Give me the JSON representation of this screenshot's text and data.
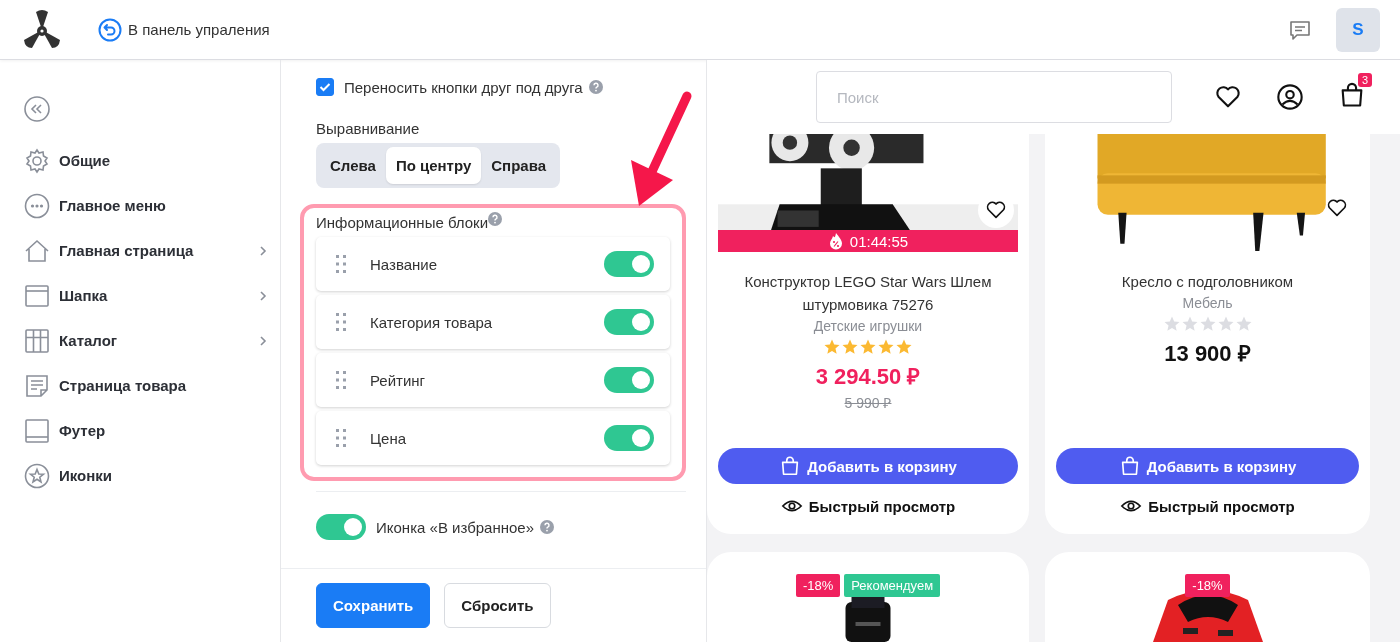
{
  "header": {
    "back_link": "В панель упраления",
    "avatar": "S"
  },
  "sidebar": {
    "items": [
      {
        "label": "Общие",
        "expandable": false
      },
      {
        "label": "Главное меню",
        "expandable": false
      },
      {
        "label": "Главная страница",
        "expandable": true
      },
      {
        "label": "Шапка",
        "expandable": true
      },
      {
        "label": "Каталог",
        "expandable": true
      },
      {
        "label": "Страница товара",
        "expandable": false
      },
      {
        "label": "Футер",
        "expandable": false
      },
      {
        "label": "Иконки",
        "expandable": false
      }
    ]
  },
  "settings": {
    "wrap_buttons": {
      "label": "Переносить кнопки друг под друга",
      "checked": true
    },
    "alignment": {
      "label": "Выравнивание",
      "options": [
        {
          "label": "Слева",
          "selected": false
        },
        {
          "label": "По центру",
          "selected": true
        },
        {
          "label": "Справа",
          "selected": false
        }
      ]
    },
    "info_blocks": {
      "title": "Информационные блоки",
      "items": [
        {
          "label": "Название",
          "on": true
        },
        {
          "label": "Категория товара",
          "on": true
        },
        {
          "label": "Рейтинг",
          "on": true
        },
        {
          "label": "Цена",
          "on": true
        }
      ]
    },
    "favorite_icon": {
      "label": "Иконка «В избранное»",
      "on": true
    },
    "buttons": {
      "save": "Сохранить",
      "reset": "Сбросить"
    }
  },
  "preview": {
    "search": {
      "placeholder": "Поиск"
    },
    "cart_count": "3",
    "products": [
      {
        "name": "Конструктор LEGO Star Wars Шлем штурмовика 75276",
        "category": "Детские игрушки",
        "stars": 5,
        "price": "3 294.50 ₽",
        "old_price": "5 990 ₽",
        "timer": "01:44:55",
        "add_button": "Добавить в корзину",
        "quick_view": "Быстрый просмотр"
      },
      {
        "name": "Кресло с подголовником",
        "category": "Мебель",
        "stars": 0,
        "price": "13 900 ₽",
        "add_button": "Добавить в корзину",
        "quick_view": "Быстрый просмотр"
      }
    ],
    "next_products": [
      {
        "badges": [
          {
            "text": "-18%",
            "kind": "discount"
          },
          {
            "text": "Рекомендуем",
            "kind": "recommended"
          }
        ]
      },
      {
        "badges": [
          {
            "text": "-18%",
            "kind": "discount"
          }
        ]
      }
    ]
  }
}
